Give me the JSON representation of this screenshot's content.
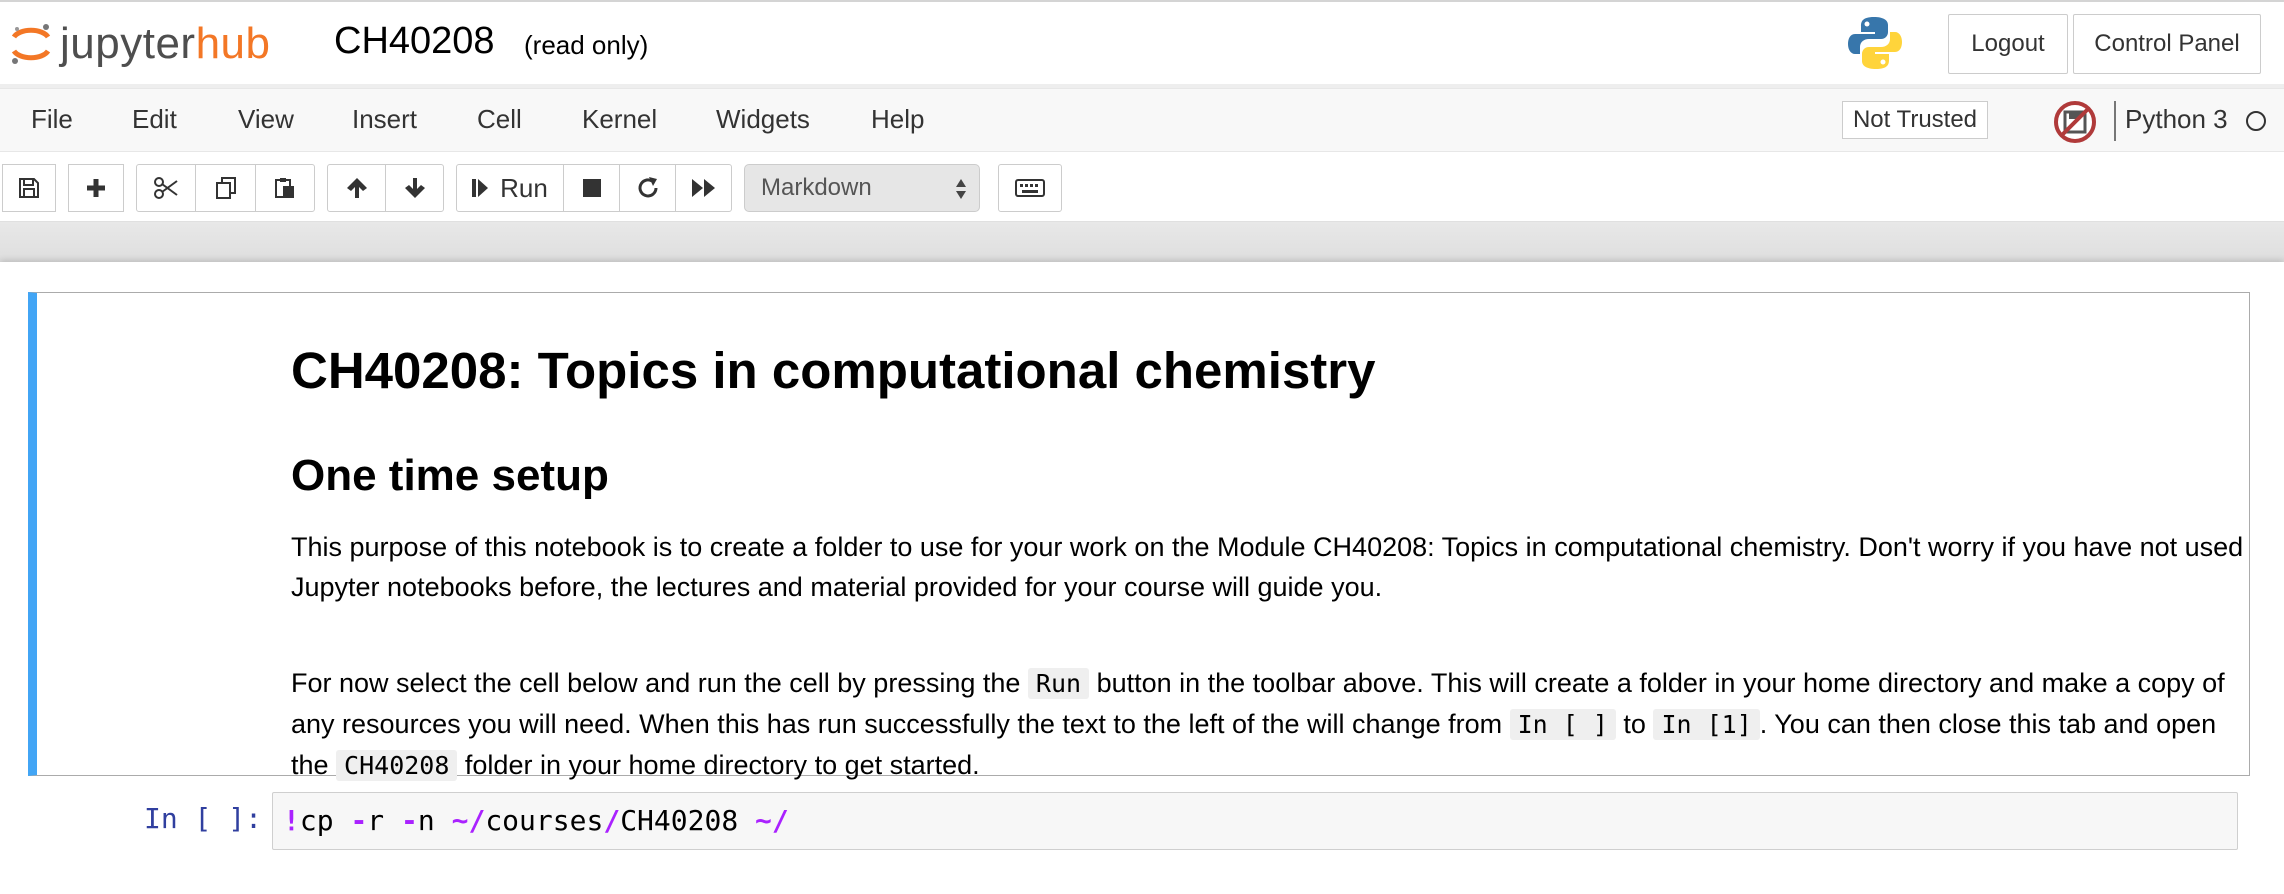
{
  "header": {
    "logo_text_left": "jupyter",
    "logo_text_right": "hub",
    "notebook_name": "CH40208",
    "read_only_label": "(read only)",
    "logout_label": "Logout",
    "control_panel_label": "Control Panel"
  },
  "menubar": {
    "items": [
      "File",
      "Edit",
      "View",
      "Insert",
      "Cell",
      "Kernel",
      "Widgets",
      "Help"
    ],
    "trust_label": "Not Trusted",
    "kernel_name": "Python 3"
  },
  "toolbar": {
    "run_label": "Run",
    "cell_type": "Markdown",
    "icons": [
      "save-icon",
      "plus-icon",
      "cut-icon",
      "copy-icon",
      "paste-icon",
      "arrow-up-icon",
      "arrow-down-icon",
      "step-forward-icon",
      "stop-icon",
      "restart-icon",
      "fast-forward-icon",
      "keyboard-icon"
    ]
  },
  "markdown_cell": {
    "title": "CH40208: Topics in computational chemistry",
    "subtitle": "One time setup",
    "para1": "This purpose of this notebook is to create a folder to use for your work on the Module CH40208: Topics in computational chemistry. Don't worry if you have not used Jupyter notebooks before, the lectures and material provided for your course will guide you.",
    "para2_a": "For now select the cell below and run the cell by pressing the ",
    "para2_code1": "Run",
    "para2_b": " button in the toolbar above. This will create a folder in your home directory and make a copy of any resources you will need. When this has run successfully the text to the left of the will change from ",
    "para2_code2": "In [ ]",
    "para2_c": " to ",
    "para2_code3": "In [1]",
    "para2_d": ". You can then close this tab and open the ",
    "para2_code4": "CH40208",
    "para2_e": " folder in your home directory to get started."
  },
  "code_cell": {
    "prompt": "In [ ]:",
    "tokens": [
      {
        "t": "!",
        "op": true
      },
      {
        "t": "cp ",
        "op": false
      },
      {
        "t": "-",
        "op": true
      },
      {
        "t": "r ",
        "op": false
      },
      {
        "t": "-",
        "op": true
      },
      {
        "t": "n ",
        "op": false
      },
      {
        "t": "~/",
        "op": true
      },
      {
        "t": "courses",
        "op": false
      },
      {
        "t": "/",
        "op": true
      },
      {
        "t": "CH40208 ",
        "op": false
      },
      {
        "t": "~/",
        "op": true
      }
    ]
  },
  "colors": {
    "jupyter_orange": "#f37726",
    "selected_cell_border": "#42a5f5",
    "prompt_blue": "#303f9f",
    "operator_purple": "#aa22ff"
  }
}
